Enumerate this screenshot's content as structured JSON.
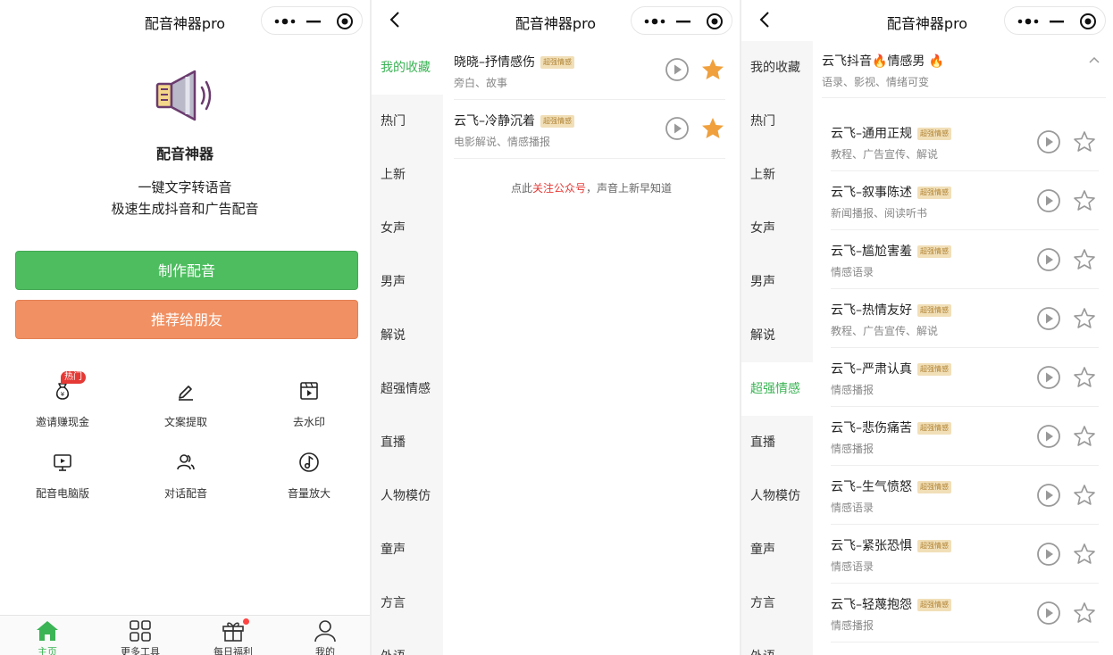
{
  "panel1": {
    "nav_title": "配音神器pro",
    "app_name": "配音神器",
    "slogan1": "一键文字转语音",
    "slogan2": "极速生成抖音和广告配音",
    "btn_make": "制作配音",
    "btn_share": "推荐给朋友",
    "hot_badge": "热门",
    "tools": [
      {
        "label": "邀请赚现金",
        "icon": "money-bag-icon"
      },
      {
        "label": "文案提取",
        "icon": "pen-icon"
      },
      {
        "label": "去水印",
        "icon": "video-frame-icon"
      },
      {
        "label": "配音电脑版",
        "icon": "monitor-play-icon"
      },
      {
        "label": "对话配音",
        "icon": "users-icon"
      },
      {
        "label": "音量放大",
        "icon": "music-note-icon"
      }
    ],
    "tabs": [
      {
        "label": "主页",
        "icon": "home-icon",
        "active": true
      },
      {
        "label": "更多工具",
        "icon": "grid-icon"
      },
      {
        "label": "每日福利",
        "icon": "gift-icon",
        "dot": true
      },
      {
        "label": "我的",
        "icon": "user-icon"
      }
    ]
  },
  "panel2": {
    "nav_title": "配音神器pro",
    "sidebar": [
      "我的收藏",
      "热门",
      "上新",
      "女声",
      "男声",
      "解说",
      "超强情感",
      "直播",
      "人物模仿",
      "童声",
      "方言",
      "外语"
    ],
    "active_index": 0,
    "items": [
      {
        "title": "晓晓–抒情感伤",
        "tag": "超强情感",
        "sub": "旁白、故事",
        "favorited": true
      },
      {
        "title": "云飞–冷静沉着",
        "tag": "超强情感",
        "sub": "电影解说、情感播报",
        "favorited": true
      }
    ],
    "tip_pre": "点此",
    "tip_link": "关注公众号",
    "tip_post": "，声音上新早知道"
  },
  "panel3": {
    "nav_title": "配音神器pro",
    "sidebar": [
      "我的收藏",
      "热门",
      "上新",
      "女声",
      "男声",
      "解说",
      "超强情感",
      "直播",
      "人物模仿",
      "童声",
      "方言",
      "外语"
    ],
    "active_index": 6,
    "group_title": "云飞抖音🔥情感男 🔥",
    "group_sub": "语录、影视、情绪可变",
    "items": [
      {
        "title": "云飞–通用正规",
        "tag": "超强情感",
        "sub": "教程、广告宣传、解说"
      },
      {
        "title": "云飞–叙事陈述",
        "tag": "超强情感",
        "sub": "新闻播报、阅读听书"
      },
      {
        "title": "云飞–尴尬害羞",
        "tag": "超强情感",
        "sub": "情感语录"
      },
      {
        "title": "云飞–热情友好",
        "tag": "超强情感",
        "sub": "教程、广告宣传、解说"
      },
      {
        "title": "云飞–严肃认真",
        "tag": "超强情感",
        "sub": "情感播报"
      },
      {
        "title": "云飞–悲伤痛苦",
        "tag": "超强情感",
        "sub": "情感播报"
      },
      {
        "title": "云飞–生气愤怒",
        "tag": "超强情感",
        "sub": "情感语录"
      },
      {
        "title": "云飞–紧张恐惧",
        "tag": "超强情感",
        "sub": "情感语录"
      },
      {
        "title": "云飞–轻蔑抱怨",
        "tag": "超强情感",
        "sub": "情感播报"
      }
    ]
  },
  "colors": {
    "green": "#4dbd5f",
    "orange": "#f19062",
    "star": "#f0a03c",
    "tag_bg": "#f1dfb8"
  }
}
